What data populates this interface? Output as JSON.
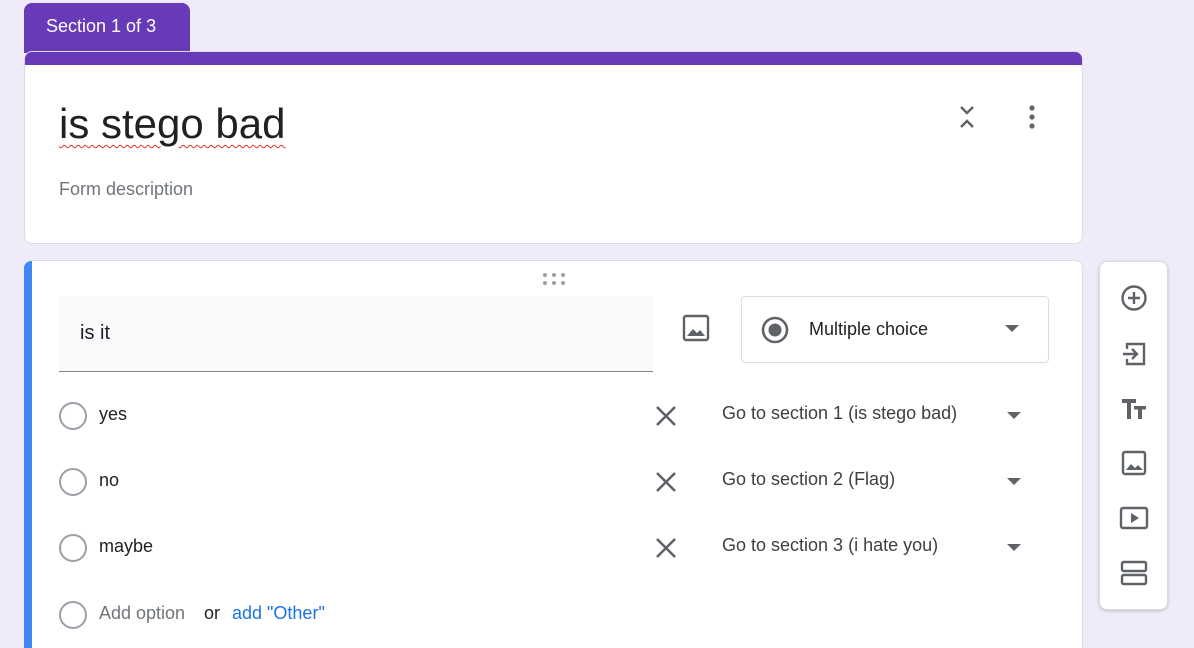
{
  "section_tab": {
    "label": "Section 1 of 3"
  },
  "form": {
    "title": "is stego bad",
    "description_placeholder": "Form description"
  },
  "question": {
    "title": "is it",
    "type": "Multiple choice",
    "options": [
      {
        "label": "yes",
        "goto": "Go to section 1 (is stego bad)"
      },
      {
        "label": "no",
        "goto": "Go to section 2 (Flag)"
      },
      {
        "label": "maybe",
        "goto": "Go to section 3 (i hate you)"
      }
    ],
    "add_option": "Add option",
    "or": "or",
    "add_other": "add \"Other\""
  },
  "toolbar": {
    "icons": [
      "add-question-icon",
      "import-questions-icon",
      "add-title-icon",
      "add-image-icon",
      "add-video-icon",
      "add-section-icon"
    ]
  },
  "colors": {
    "accent": "#673ab7",
    "active_question": "#4285f4",
    "link": "#1a73e8",
    "background": "#f0ebf8"
  }
}
